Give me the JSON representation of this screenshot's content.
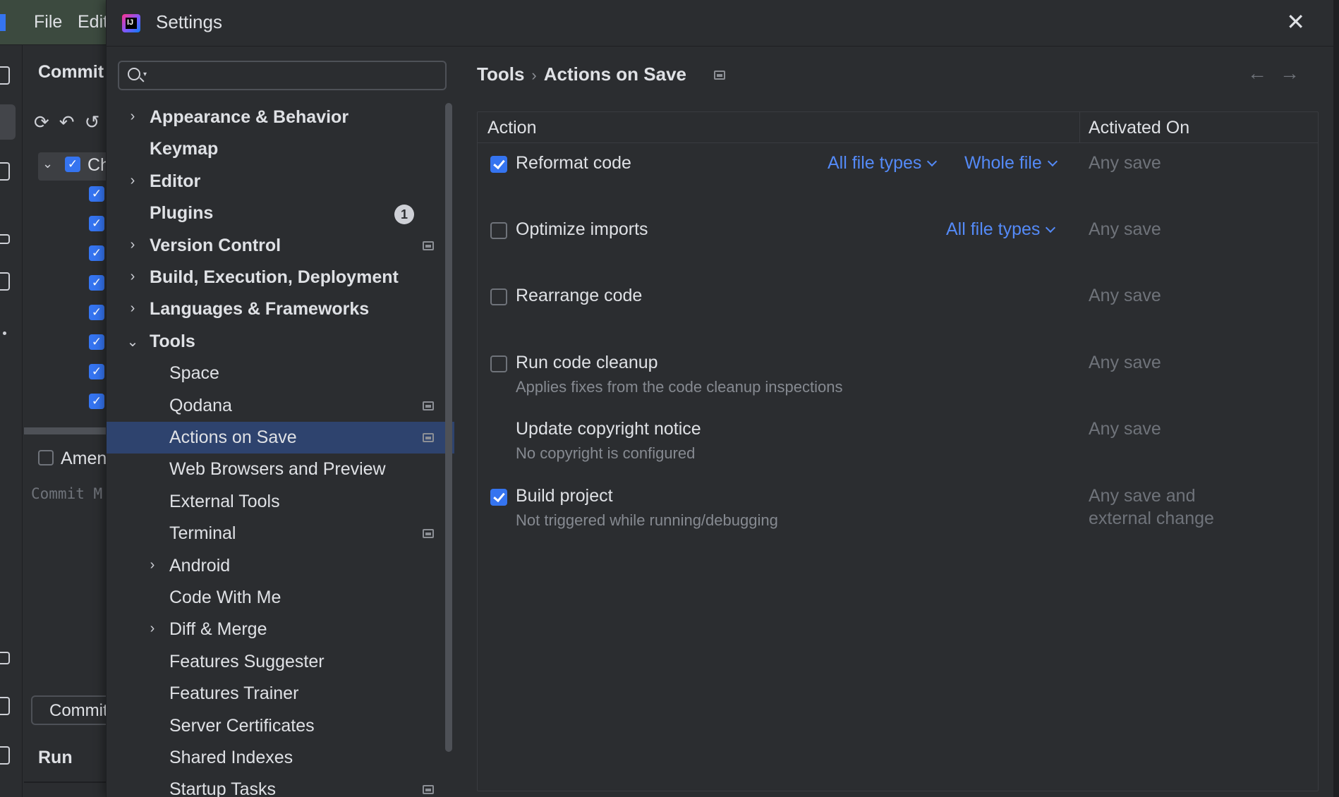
{
  "ide": {
    "menu_file": "File",
    "menu_edit": "Edit",
    "commit_title": "Commit",
    "changes_label": "Ch",
    "amend_label": "Amend",
    "commit_message_placeholder": "Commit M",
    "commit_button": "Commit",
    "run_label": "Run"
  },
  "dialog": {
    "title": "Settings",
    "search": {
      "placeholder": "",
      "value": ""
    },
    "nav": [
      {
        "label": "Appearance & Behavior",
        "expandable": true,
        "bold": true
      },
      {
        "label": "Keymap",
        "expandable": false,
        "bold": true
      },
      {
        "label": "Editor",
        "expandable": true,
        "bold": true
      },
      {
        "label": "Plugins",
        "expandable": false,
        "bold": true,
        "badge": "1"
      },
      {
        "label": "Version Control",
        "expandable": true,
        "bold": true,
        "project_icon": true
      },
      {
        "label": "Build, Execution, Deployment",
        "expandable": true,
        "bold": true
      },
      {
        "label": "Languages & Frameworks",
        "expandable": true,
        "bold": true
      },
      {
        "label": "Tools",
        "expanded": true,
        "bold": true
      },
      {
        "label": "Space"
      },
      {
        "label": "Qodana",
        "project_icon": true
      },
      {
        "label": "Actions on Save",
        "selected": true,
        "project_icon": true
      },
      {
        "label": "Web Browsers and Preview"
      },
      {
        "label": "External Tools"
      },
      {
        "label": "Terminal",
        "project_icon": true
      },
      {
        "label": "Android",
        "expandable": true
      },
      {
        "label": "Code With Me"
      },
      {
        "label": "Diff & Merge",
        "expandable": true
      },
      {
        "label": "Features Suggester"
      },
      {
        "label": "Features Trainer"
      },
      {
        "label": "Server Certificates"
      },
      {
        "label": "Shared Indexes"
      },
      {
        "label": "Startup Tasks",
        "project_icon": true
      }
    ],
    "breadcrumb": {
      "parent": "Tools",
      "separator": "›",
      "current": "Actions on Save"
    },
    "table": {
      "col_action": "Action",
      "col_activated": "Activated On",
      "rows": [
        {
          "label": "Reformat code",
          "checked": true,
          "file_types": "All file types",
          "scope": "Whole file",
          "activated": "Any save"
        },
        {
          "label": "Optimize imports",
          "checked": false,
          "file_types": "All file types",
          "activated": "Any save"
        },
        {
          "label": "Rearrange code",
          "checked": false,
          "activated": "Any save"
        },
        {
          "label": "Run code cleanup",
          "checked": false,
          "description": "Applies fixes from the code cleanup inspections",
          "activated": "Any save"
        },
        {
          "label": "Update copyright notice",
          "no_checkbox": true,
          "description": "No copyright is configured",
          "activated": "Any save"
        },
        {
          "label": "Build project",
          "checked": true,
          "description": "Not triggered while running/debugging",
          "activated_line1": "Any save and",
          "activated_line2": "external change"
        }
      ]
    }
  },
  "colors": {
    "accent": "#3574f0",
    "link": "#548af7",
    "selection": "#2e436e",
    "background": "#2b2d30"
  },
  "icons": [
    "search-icon",
    "close-icon",
    "chevron-right-icon",
    "chevron-down-icon",
    "project-scope-icon",
    "back-arrow-icon",
    "forward-arrow-icon"
  ]
}
